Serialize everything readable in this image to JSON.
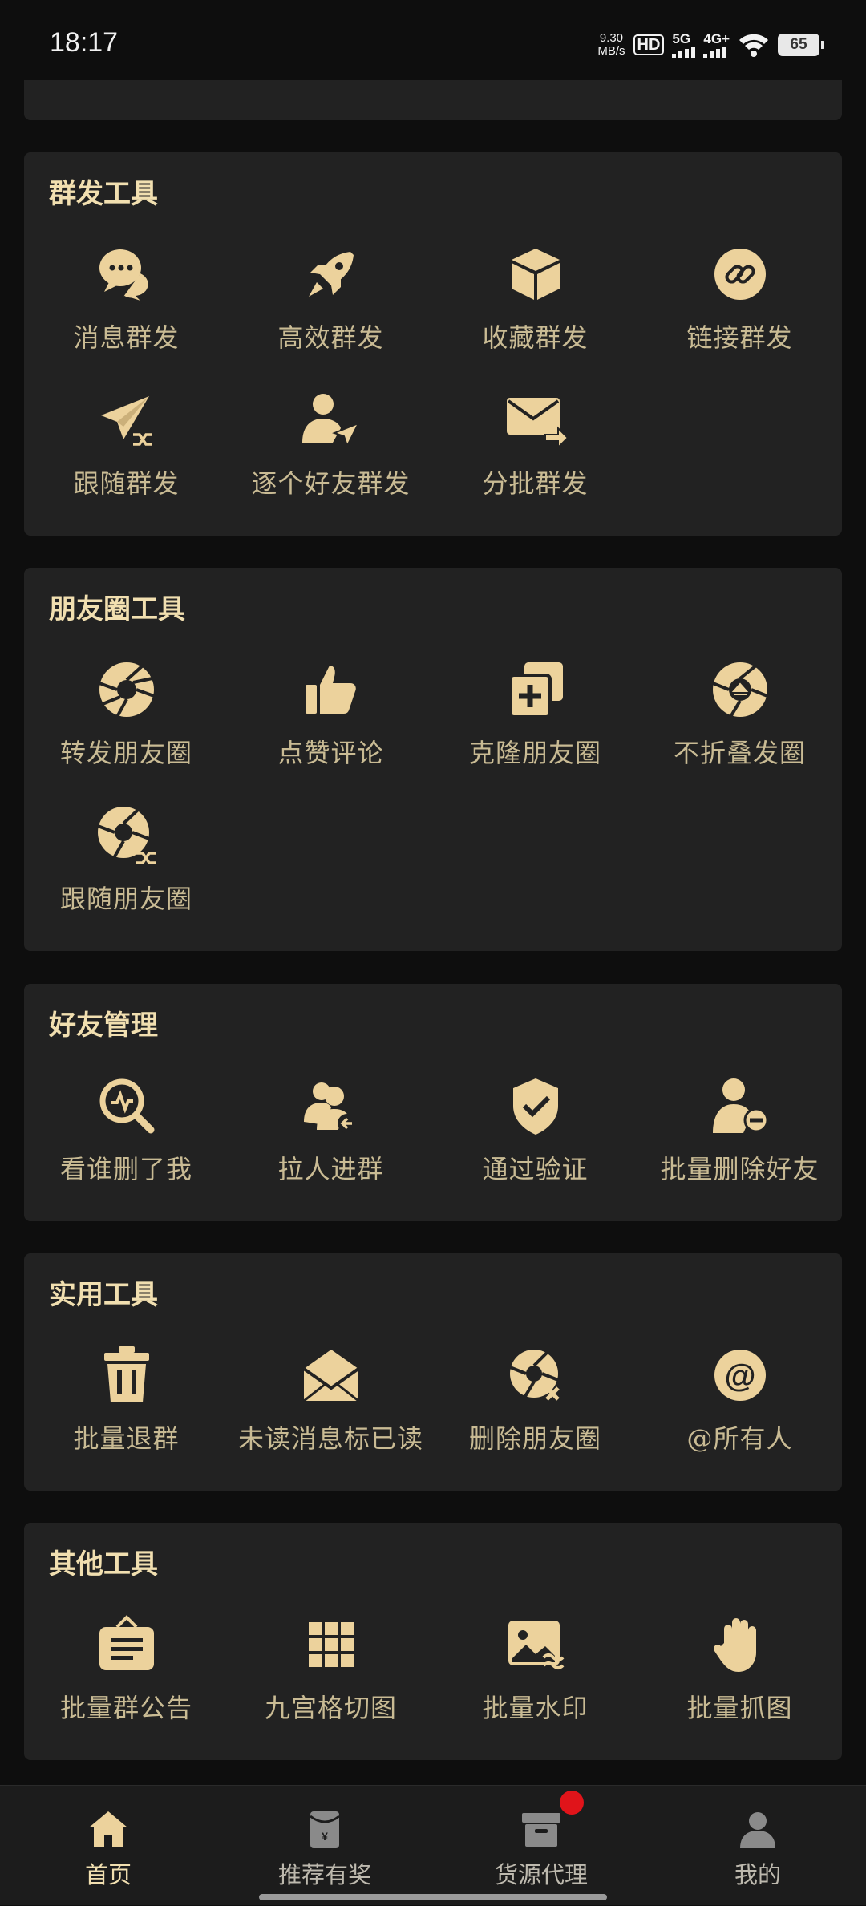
{
  "status_bar": {
    "time": "18:17",
    "net_speed_value": "9.30",
    "net_speed_unit": "MB/s",
    "hd": "HD",
    "sim_5g": "5G",
    "sim_4g": "4G+",
    "battery": "65"
  },
  "colors": {
    "gold": "#f1dfb0",
    "icon": "#ecd29c",
    "card": "#222222",
    "bg": "#0e0e0e",
    "badge": "#e0141a"
  },
  "sections": {
    "mass_send": {
      "title": "群发工具",
      "items": [
        {
          "label": "消息群发",
          "icon": "chat-bubbles-icon"
        },
        {
          "label": "高效群发",
          "icon": "rocket-icon"
        },
        {
          "label": "收藏群发",
          "icon": "box-icon"
        },
        {
          "label": "链接群发",
          "icon": "link-icon"
        },
        {
          "label": "跟随群发",
          "icon": "paper-plane-shuffle-icon"
        },
        {
          "label": "逐个好友群发",
          "icon": "user-send-icon"
        },
        {
          "label": "分批群发",
          "icon": "envelope-forward-icon"
        }
      ]
    },
    "moments": {
      "title": "朋友圈工具",
      "items": [
        {
          "label": "转发朋友圈",
          "icon": "aperture-icon"
        },
        {
          "label": "点赞评论",
          "icon": "thumbs-up-icon"
        },
        {
          "label": "克隆朋友圈",
          "icon": "clone-plus-icon"
        },
        {
          "label": "不折叠发圈",
          "icon": "aperture-eject-icon"
        },
        {
          "label": "跟随朋友圈",
          "icon": "aperture-shuffle-icon"
        }
      ]
    },
    "friends": {
      "title": "好友管理",
      "items": [
        {
          "label": "看谁删了我",
          "icon": "search-pulse-icon"
        },
        {
          "label": "拉人进群",
          "icon": "users-add-icon"
        },
        {
          "label": "通过验证",
          "icon": "shield-check-icon"
        },
        {
          "label": "批量删除好友",
          "icon": "user-remove-icon"
        }
      ]
    },
    "utility": {
      "title": "实用工具",
      "items": [
        {
          "label": "批量退群",
          "icon": "trash-icon"
        },
        {
          "label": "未读消息标已读",
          "icon": "envelope-open-icon"
        },
        {
          "label": "删除朋友圈",
          "icon": "aperture-delete-icon"
        },
        {
          "label": "@所有人",
          "icon": "at-sign-icon"
        }
      ]
    },
    "other": {
      "title": "其他工具",
      "items": [
        {
          "label": "批量群公告",
          "icon": "notice-board-icon"
        },
        {
          "label": "九宫格切图",
          "icon": "grid-icon"
        },
        {
          "label": "批量水印",
          "icon": "image-watermark-icon"
        },
        {
          "label": "批量抓图",
          "icon": "hand-grab-icon"
        }
      ]
    }
  },
  "tabs": [
    {
      "label": "首页",
      "icon": "home-icon",
      "active": true
    },
    {
      "label": "推荐有奖",
      "icon": "red-envelope-icon",
      "active": false
    },
    {
      "label": "货源代理",
      "icon": "archive-box-icon",
      "active": false,
      "badge": true
    },
    {
      "label": "我的",
      "icon": "user-icon",
      "active": false
    }
  ]
}
